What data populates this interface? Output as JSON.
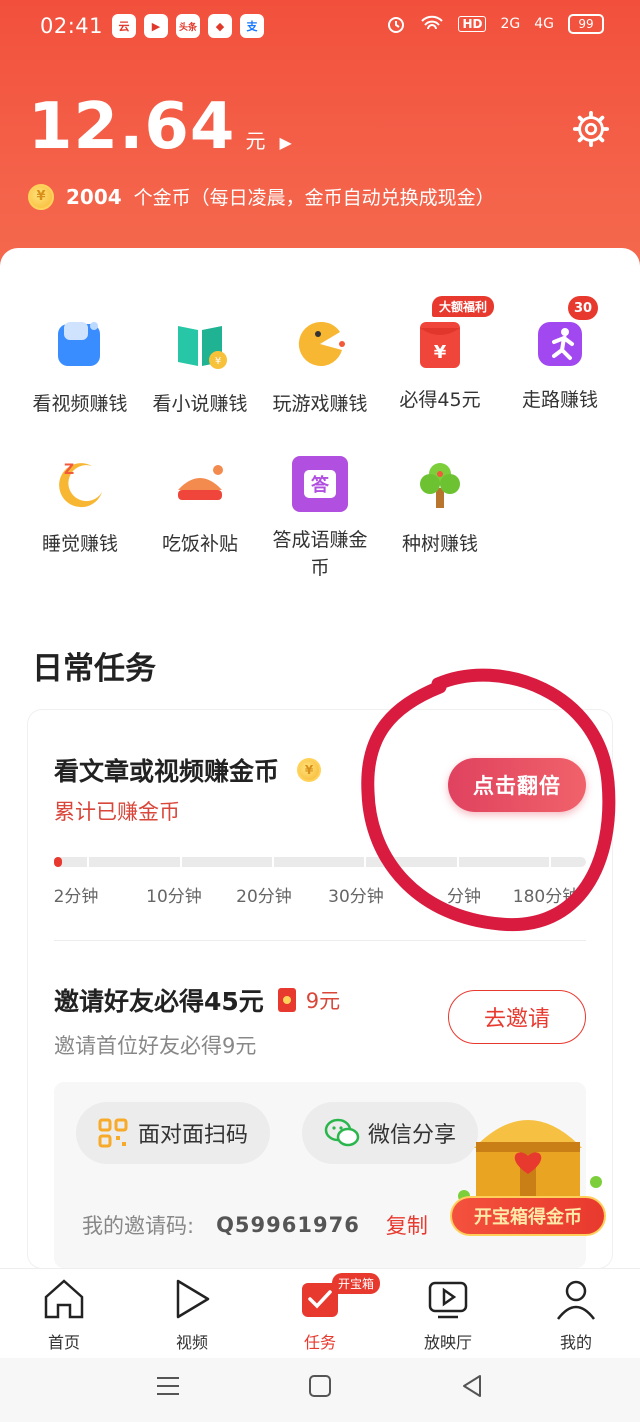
{
  "status_bar": {
    "time": "02:41",
    "apps": [
      "云",
      "▶",
      "头条",
      "◆",
      "支"
    ],
    "network_hd": "HD",
    "signal1": "2G",
    "signal2": "4G",
    "battery": "99"
  },
  "header": {
    "balance": "12.64",
    "balance_unit": "元",
    "coin_symbol": "¥",
    "coin_count": "2004",
    "coin_desc": "个金币（每日凌晨，金币自动兑换成现金）"
  },
  "grid": [
    {
      "label": "看视频赚钱",
      "icon": "video-icon"
    },
    {
      "label": "看小说赚钱",
      "icon": "book-icon"
    },
    {
      "label": "玩游戏赚钱",
      "icon": "pacman-icon"
    },
    {
      "label": "必得45元",
      "icon": "red-envelope-icon",
      "badge": "大额福利"
    },
    {
      "label": "走路赚钱",
      "icon": "running-icon",
      "badge": "30"
    },
    {
      "label": "睡觉赚钱",
      "icon": "moon-icon"
    },
    {
      "label": "吃饭补贴",
      "icon": "chicken-icon"
    },
    {
      "label": "答成语赚金币",
      "icon": "quiz-book-icon",
      "icon_text": "答"
    },
    {
      "label": "种树赚钱",
      "icon": "tree-icon"
    }
  ],
  "daily": {
    "section_title": "日常任务",
    "task_title": "看文章或视频赚金币",
    "task_sub": "累计已赚金币",
    "double_button": "点击翻倍",
    "progress_fraction": 0.015,
    "ticks": [
      "2分钟",
      "10分钟",
      "20分钟",
      "30分钟",
      "分钟",
      "180分钟"
    ]
  },
  "invite": {
    "title": "邀请好友必得45元",
    "amount": "9元",
    "subtitle": "邀请首位好友必得9元",
    "button": "去邀请",
    "face_scan": "面对面扫码",
    "wechat_share": "微信分享",
    "code_label": "我的邀请码:",
    "code_value": "Q59961976",
    "copy": "复制"
  },
  "treasure": {
    "label": "开宝箱得金币"
  },
  "bottom_nav": [
    {
      "label": "首页",
      "icon": "home-icon"
    },
    {
      "label": "视频",
      "icon": "play-icon"
    },
    {
      "label": "任务",
      "icon": "task-icon",
      "active": true,
      "badge": "开宝箱"
    },
    {
      "label": "放映厅",
      "icon": "theater-icon"
    },
    {
      "label": "我的",
      "icon": "profile-icon"
    }
  ],
  "colors": {
    "brand_red": "#e8392f",
    "hero_top": "#f2503c",
    "coin_gold": "#f7b733"
  }
}
